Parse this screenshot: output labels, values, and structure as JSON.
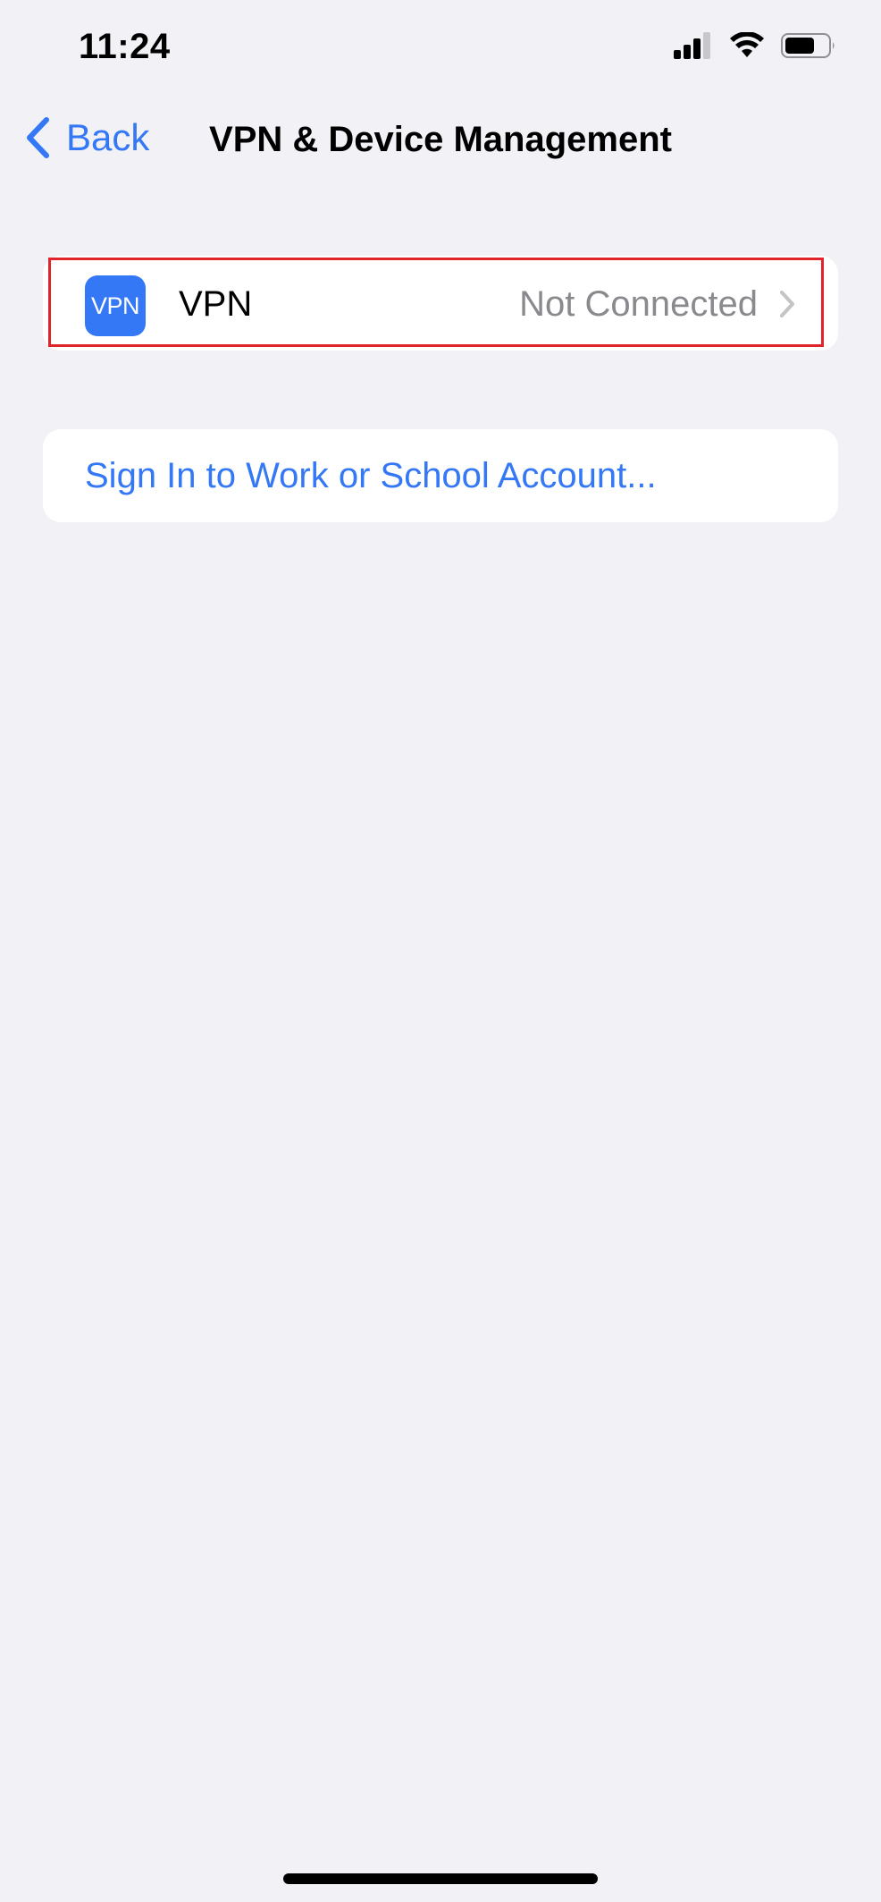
{
  "status_bar": {
    "time": "11:24",
    "icons": [
      "cellular-signal-icon",
      "wifi-icon",
      "battery-icon"
    ]
  },
  "nav": {
    "back_label": "Back",
    "title": "VPN & Device Management"
  },
  "vpn_row": {
    "icon_text": "VPN",
    "label": "VPN",
    "status": "Not Connected"
  },
  "signin_row": {
    "label": "Sign In to Work or School Account..."
  },
  "colors": {
    "accent": "#3478f6",
    "background": "#f1f1f6",
    "secondary_text": "#8a8a8e",
    "highlight": "#e0242b"
  }
}
